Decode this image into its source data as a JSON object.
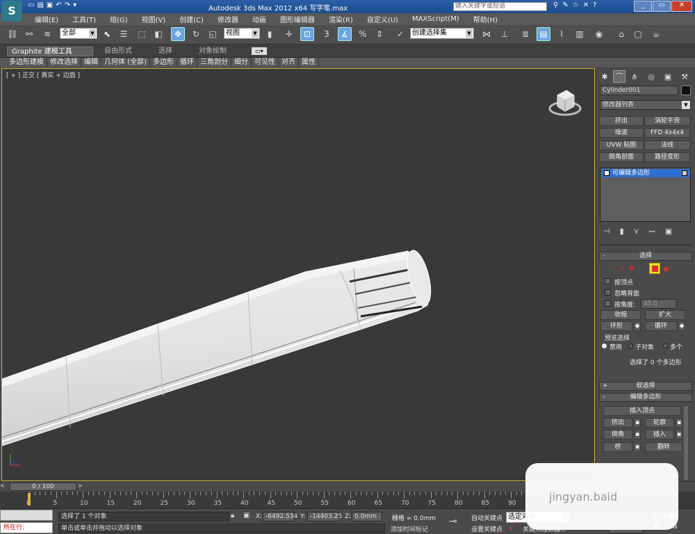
{
  "window": {
    "title": "Autodesk 3ds Max  2012 x64     写字笔.max",
    "search_placeholder": "键入关键字或短语"
  },
  "menu": [
    "编辑(E)",
    "工具(T)",
    "组(G)",
    "视图(V)",
    "创建(C)",
    "修改器",
    "动画",
    "图形编辑器",
    "渲染(R)",
    "自定义(U)",
    "MAXScript(M)",
    "帮助(H)"
  ],
  "toolbar": {
    "filter": "全部",
    "refcoord": "视图",
    "snap_angle_label": "3",
    "percent_label": "%",
    "selset": "创建选择集"
  },
  "ribbon": {
    "tabs": [
      "Graphite 建模工具",
      "自由形式",
      "选择",
      "对象绘制"
    ]
  },
  "subribbon": [
    "多边形建模",
    "修改选择",
    "编辑",
    "几何体 (全部)",
    "多边形",
    "循环",
    "三角剖分",
    "细分",
    "可见性",
    "对齐",
    "属性"
  ],
  "viewport": {
    "label": "[ + ] 正交 [ 真实 + 边面 ]"
  },
  "panel": {
    "object_name": "Cylinder001",
    "modifier_list": "修改器列表",
    "mod_buttons": [
      "挤出",
      "涡轮平滑",
      "噪波",
      "FFD 4x4x4",
      "UVW 贴图",
      "法线",
      "倒角剖面",
      "路径变形"
    ],
    "stack_item": "可编辑多边形",
    "selection": {
      "title": "选择",
      "by_vertex": "按顶点",
      "ignore_backfacing": "忽略背面",
      "by_angle": "按角度:",
      "angle_value": "45.0",
      "shrink": "收缩",
      "grow": "扩大",
      "ring": "环形",
      "loop": "循环",
      "preview_title": "预览选择",
      "preview_off": "禁用",
      "preview_sub": "子对象",
      "preview_multi": "多个",
      "status": "选择了 0 个多边形"
    },
    "soft_selection": "软选择",
    "edit_poly": {
      "title": "编辑多边形",
      "insert_vertex": "插入顶点",
      "extrude": "挤出",
      "outline": "轮廓",
      "bevel": "倒角",
      "inset": "插入",
      "bridge": "桥",
      "flip": "翻转",
      "partial_label": "转"
    }
  },
  "timeline": {
    "counter": "0 / 100",
    "ticks": [
      "0",
      "5",
      "10",
      "15",
      "20",
      "25",
      "30",
      "35",
      "40",
      "45",
      "50",
      "55",
      "60",
      "65",
      "70",
      "75",
      "80",
      "85",
      "90"
    ]
  },
  "status": {
    "mode": "所在行:",
    "selected": "选择了 1 个对象",
    "hint": "单击或单击并拖动以选择对象",
    "x_label": "X:",
    "x": "-6492.534",
    "y_label": "Y:",
    "y": "-14403.25",
    "z_label": "Z:",
    "z": "0.0mm",
    "grid": "栅格 = 0.0mm",
    "autokey": "自动关键点",
    "setkey": "设置关键点",
    "key_filter": "关键点过滤器...",
    "selected_obj": "选定对象",
    "add_time_tag": "添加时间标记",
    "frame": "0"
  },
  "watermark": "jingyan.baid",
  "colors": {
    "accent": "#6aa4e0",
    "viewport_border": "#d9b53d",
    "selected_red": "#d83030",
    "stack_blue": "#2f6fd0"
  }
}
